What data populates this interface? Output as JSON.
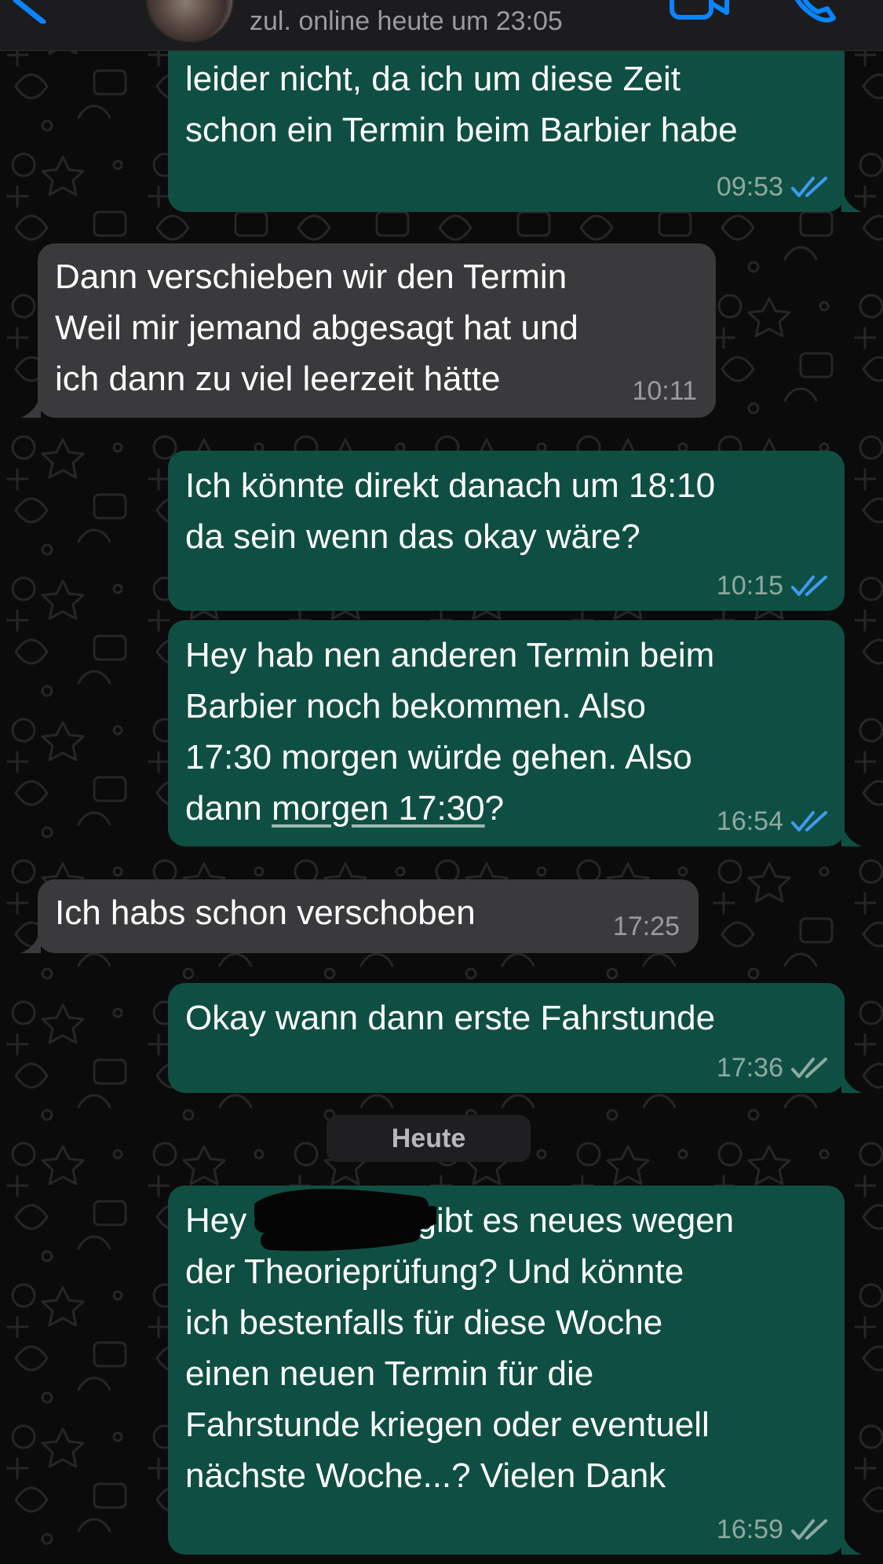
{
  "header": {
    "last_seen": "zul. online heute um 23:05"
  },
  "messages": [
    {
      "direction": "out",
      "text": "leider nicht, da ich um diese Zeit\nschon ein Termin beim Barbier habe",
      "time": "09:53",
      "status": "read"
    },
    {
      "direction": "in",
      "text": "Dann verschieben wir den Termin\nWeil mir jemand abgesagt hat und\nich dann zu viel leerzeit hätte",
      "time": "10:11"
    },
    {
      "direction": "out",
      "text": "Ich könnte direkt danach um 18:10\nda sein wenn das okay wäre?",
      "time": "10:15",
      "status": "read"
    },
    {
      "direction": "out",
      "text_lines": [
        "Hey hab nen anderen Termin beim",
        "Barbier noch bekommen. Also",
        "17:30 morgen würde gehen. Also"
      ],
      "text_last_prefix": "dann ",
      "text_link": "morgen 17:30",
      "text_last_suffix": "?",
      "time": "16:54",
      "status": "read"
    },
    {
      "direction": "in",
      "text": "Ich habs schon verschoben",
      "time": "17:25"
    },
    {
      "direction": "out",
      "text": "Okay wann dann erste Fahrstunde",
      "time": "17:36",
      "status": "delivered"
    },
    {
      "direction": "out",
      "text_first_prefix": "Hey ",
      "text_first_suffix": "gibt es neues wegen",
      "text_rest": "der Theorieprüfung? Und könnte\nich bestenfalls für diese Woche\neinen neuen Termin für die\nFahrstunde kriegen oder eventuell\nnächste Woche...? Vielen Dank",
      "time": "16:59",
      "status": "delivered"
    }
  ],
  "day_separator": "Heute",
  "colors": {
    "outgoing_bubble": "#0f4f43",
    "incoming_bubble": "#3a3a3c",
    "read_ticks": "#3d9bf0",
    "delivered_ticks": "#8fa8a0",
    "accent_blue": "#0a84ff"
  },
  "icons": [
    "back-arrow-icon",
    "video-call-icon",
    "phone-call-icon",
    "double-check-read-icon",
    "double-check-delivered-icon"
  ]
}
